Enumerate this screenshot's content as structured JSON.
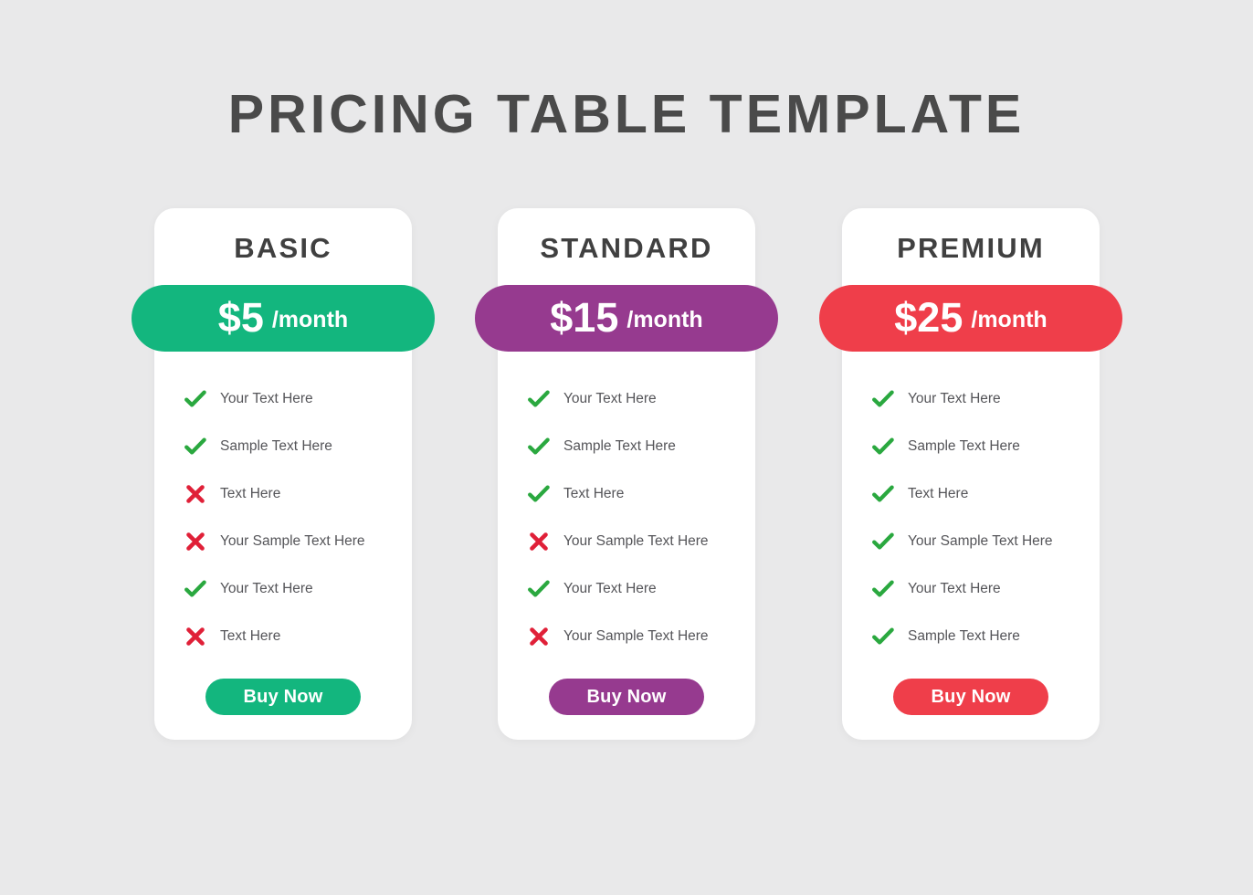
{
  "page": {
    "title": "PRICING TABLE TEMPLATE",
    "background_color": "#e9e9ea",
    "title_color": "#4a4a4a"
  },
  "icons": {
    "check": "check-icon",
    "cross": "cross-icon",
    "check_color": "#2aa83f",
    "cross_color": "#e02038"
  },
  "plans": [
    {
      "name": "BASIC",
      "price": "$5",
      "period": "/month",
      "accent_color": "#13b67e",
      "banner_color": "#13b67e",
      "button_label": "Buy Now",
      "button_color": "#13b67e",
      "features": [
        {
          "label": "Your Text Here",
          "icon": "check"
        },
        {
          "label": "Sample Text Here",
          "icon": "check"
        },
        {
          "label": "Text Here",
          "icon": "cross"
        },
        {
          "label": "Your Sample Text Here",
          "icon": "cross"
        },
        {
          "label": "Your Text Here",
          "icon": "check"
        },
        {
          "label": "Text Here",
          "icon": "cross"
        }
      ]
    },
    {
      "name": "STANDARD",
      "price": "$15",
      "period": "/month",
      "accent_color": "#963a8f",
      "banner_color": "#963a8f",
      "button_label": "Buy Now",
      "button_color": "#963a8f",
      "features": [
        {
          "label": "Your Text Here",
          "icon": "check"
        },
        {
          "label": "Sample Text Here",
          "icon": "check"
        },
        {
          "label": "Text Here",
          "icon": "check"
        },
        {
          "label": "Your Sample Text Here",
          "icon": "cross"
        },
        {
          "label": "Your Text Here",
          "icon": "check"
        },
        {
          "label": "Your Sample Text Here",
          "icon": "cross"
        }
      ]
    },
    {
      "name": "PREMIUM",
      "price": "$25",
      "period": "/month",
      "accent_color": "#ef3e4a",
      "banner_color": "#ef3e4a",
      "button_label": "Buy Now",
      "button_color": "#ef3e4a",
      "features": [
        {
          "label": "Your Text Here",
          "icon": "check"
        },
        {
          "label": "Sample Text Here",
          "icon": "check"
        },
        {
          "label": "Text Here",
          "icon": "check"
        },
        {
          "label": "Your Sample Text Here",
          "icon": "check"
        },
        {
          "label": "Your Text Here",
          "icon": "check"
        },
        {
          "label": "Sample Text Here",
          "icon": "check"
        }
      ]
    }
  ]
}
